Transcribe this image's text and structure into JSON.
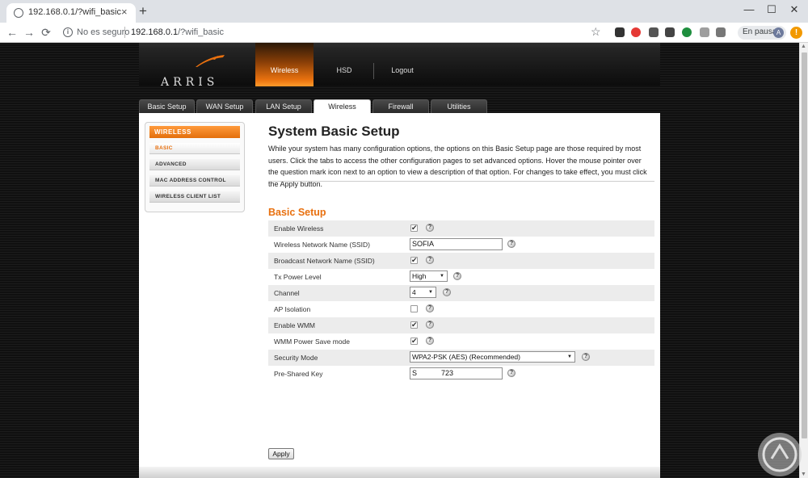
{
  "browser": {
    "tab_title": "192.168.0.1/?wifi_basic",
    "tab_close": "×",
    "new_tab": "+",
    "win_minimize": "—",
    "win_maximize": "☐",
    "win_close": "✕",
    "back": "←",
    "forward": "→",
    "reload": "⟳",
    "info": "i",
    "not_secure": "No es seguro",
    "url_host": "192.168.0.1",
    "url_path": "/?wifi_basic",
    "bookmark_star": "☆",
    "profile_label": "En pausa",
    "profile_initial": "A",
    "update_badge": "!"
  },
  "header": {
    "logo_text": "ARRIS",
    "nav": [
      {
        "label": "Wireless",
        "active": true
      },
      {
        "label": "HSD",
        "active": false
      },
      {
        "label": "Logout",
        "active": false
      }
    ]
  },
  "tabs": [
    {
      "label": "Basic Setup",
      "active": false
    },
    {
      "label": "WAN Setup",
      "active": false
    },
    {
      "label": "LAN Setup",
      "active": false
    },
    {
      "label": "Wireless",
      "active": true
    },
    {
      "label": "Firewall",
      "active": false
    },
    {
      "label": "Utilities",
      "active": false
    }
  ],
  "sidebar": {
    "heading": "WIRELESS",
    "items": [
      {
        "label": "BASIC",
        "active": true
      },
      {
        "label": "ADVANCED",
        "active": false
      },
      {
        "label": "MAC ADDRESS CONTROL",
        "active": false
      },
      {
        "label": "WIRELESS CLIENT LIST",
        "active": false
      }
    ]
  },
  "main": {
    "title": "System Basic Setup",
    "description": "While your system has many configuration options, the options on this Basic Setup page are those required by most users. Click the tabs to access the other configuration pages to set advanced options. Hover the mouse pointer over the question mark icon next to an option to view a description of that option. For changes to take effect, you must click the Apply button.",
    "section_title": "Basic Setup",
    "help_symbol": "?",
    "check_symbol": "✔",
    "select_arrow": "▼",
    "settings": [
      {
        "label": "Enable Wireless",
        "type": "checkbox",
        "checked": true
      },
      {
        "label": "Wireless Network Name (SSID)",
        "type": "text",
        "value": "SOFIA"
      },
      {
        "label": "Broadcast Network Name (SSID)",
        "type": "checkbox",
        "checked": true
      },
      {
        "label": "Tx Power Level",
        "type": "select",
        "value": "High"
      },
      {
        "label": "Channel",
        "type": "select",
        "value": "4"
      },
      {
        "label": "AP Isolation",
        "type": "checkbox",
        "checked": false
      },
      {
        "label": "Enable WMM",
        "type": "checkbox",
        "checked": true
      },
      {
        "label": "WMM Power Save mode",
        "type": "checkbox",
        "checked": true
      },
      {
        "label": "Security Mode",
        "type": "select",
        "value": "WPA2-PSK (AES) (Recommended)"
      },
      {
        "label": "Pre-Shared Key",
        "type": "text",
        "value": "S            723"
      }
    ],
    "apply_label": "Apply"
  },
  "colors": {
    "accent_orange": "#e8700f",
    "page_background": "#161616",
    "row_shade": "#ececec"
  }
}
